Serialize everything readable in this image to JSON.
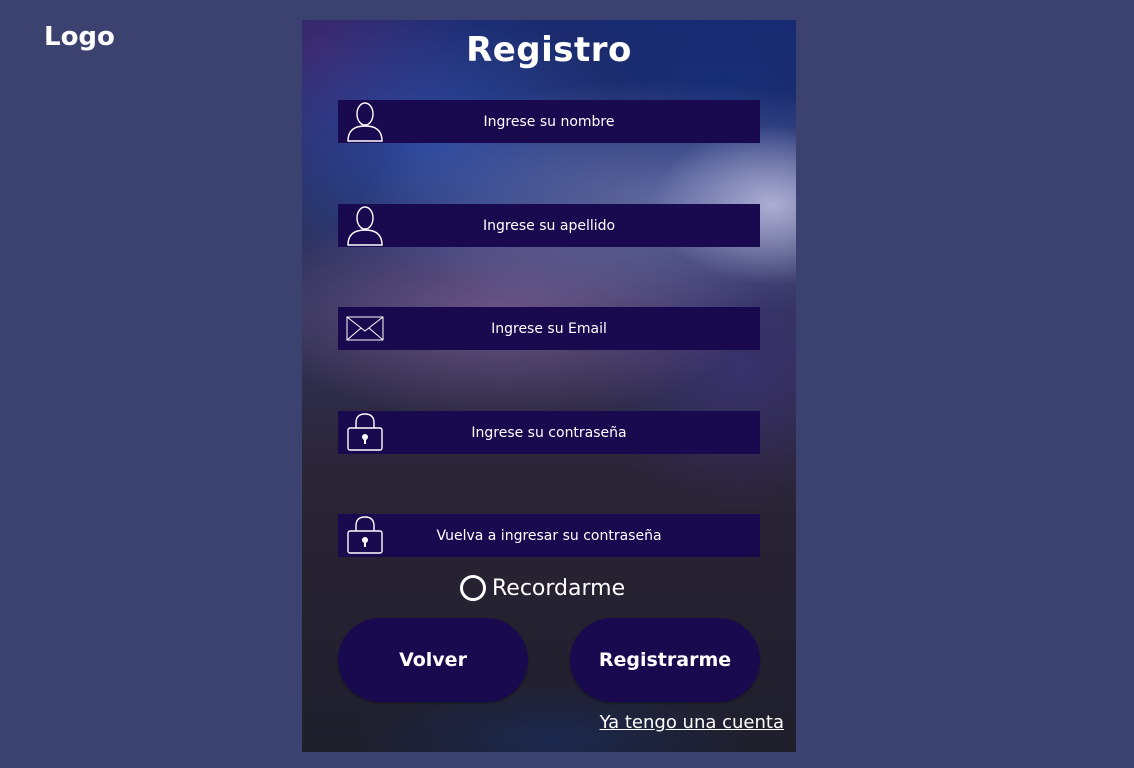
{
  "header": {
    "logo_text": "Logo"
  },
  "form": {
    "title": "Registro",
    "fields": [
      {
        "placeholder": "Ingrese su nombre",
        "icon": "user-icon"
      },
      {
        "placeholder": "Ingrese su apellido",
        "icon": "user-icon"
      },
      {
        "placeholder": "Ingrese su Email",
        "icon": "envelope-icon"
      },
      {
        "placeholder": "Ingrese su contraseña",
        "icon": "lock-icon"
      },
      {
        "placeholder": "Vuelva a ingresar su contraseña",
        "icon": "lock-icon"
      }
    ],
    "remember_label": "Recordarme",
    "back_button": "Volver",
    "register_button": "Registrarme",
    "login_link": "Ya tengo una cuenta"
  },
  "colors": {
    "page_background": "#3b4270",
    "field_background": "#19094f",
    "button_background": "#19094f",
    "text": "#ffffff"
  }
}
